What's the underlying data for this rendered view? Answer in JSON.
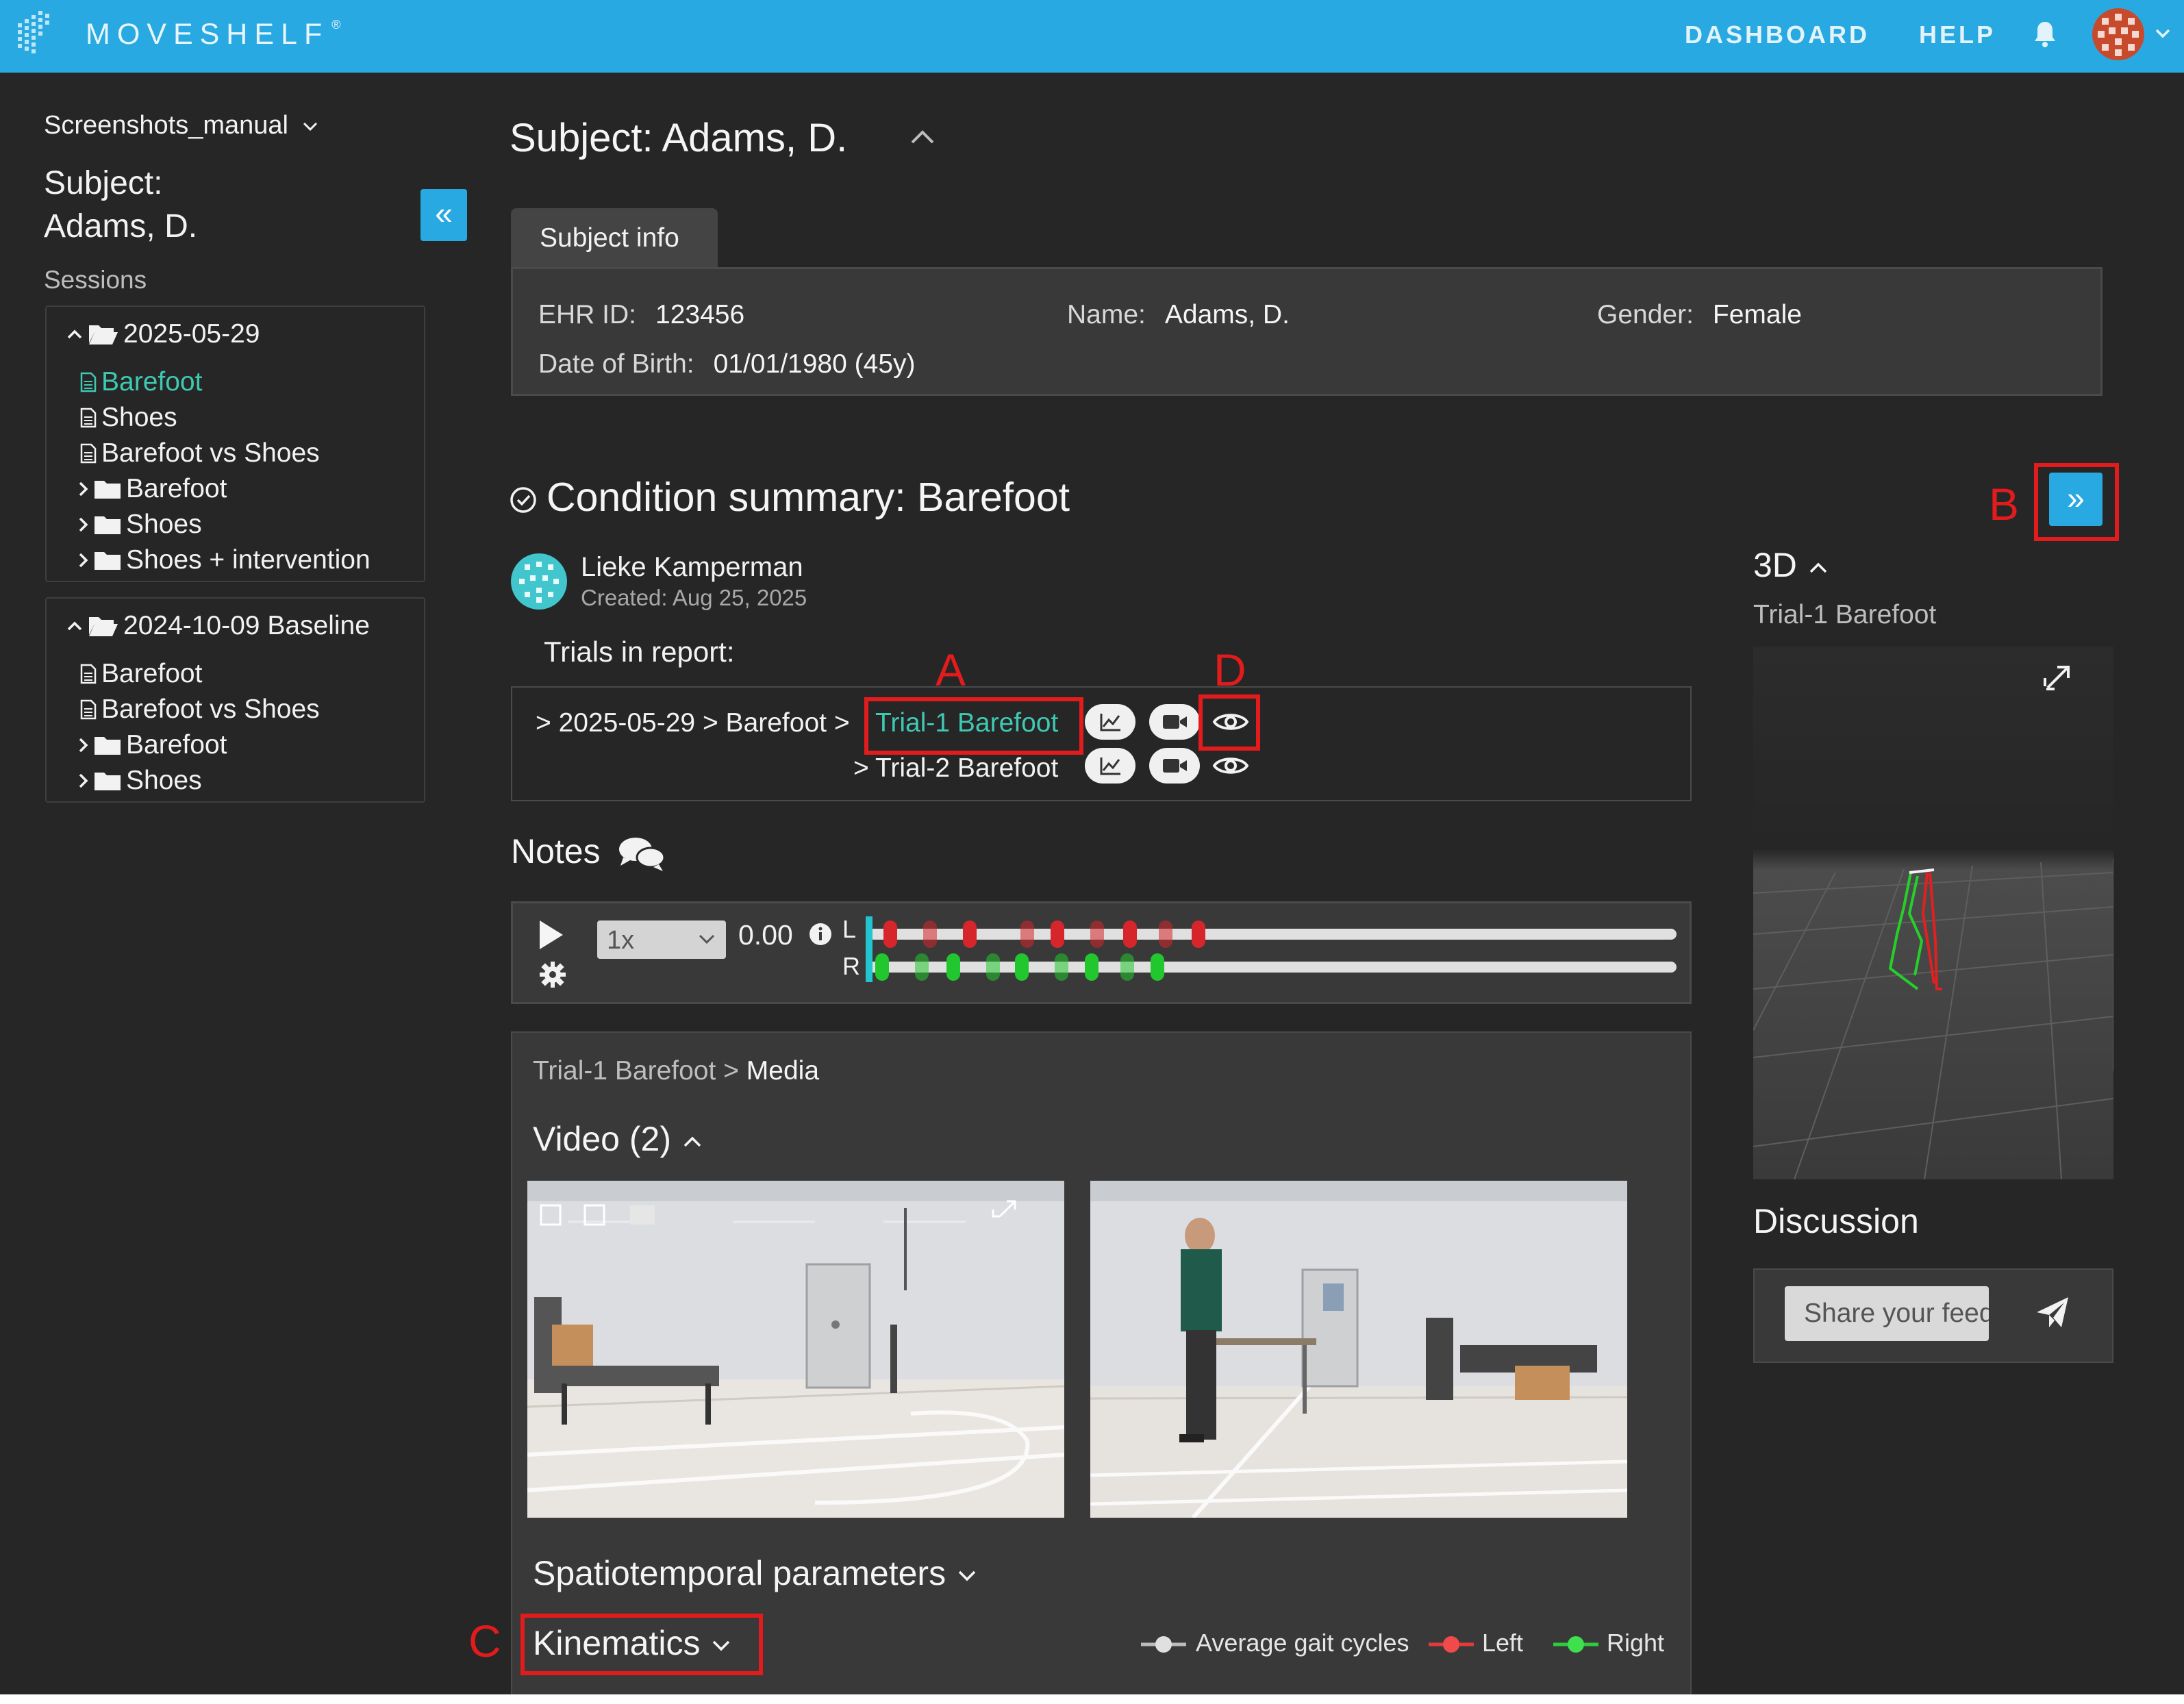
{
  "topbar": {
    "logo": "MOVESHELF",
    "logo_mark": "®",
    "nav": {
      "dashboard": "DASHBOARD",
      "help": "HELP"
    },
    "icons": [
      "logo-icon",
      "bell-icon",
      "user-avatar",
      "chevron-down-icon"
    ]
  },
  "sidebar": {
    "project": "Screenshots_manual",
    "subject_line1": "Subject:",
    "subject_line2": "Adams, D.",
    "collapse_label": "«",
    "sessions_label": "Sessions",
    "sessions": [
      {
        "date": "2025-05-29",
        "items": [
          {
            "label": "Barefoot",
            "type": "report",
            "active": true
          },
          {
            "label": "Shoes",
            "type": "report"
          },
          {
            "label": "Barefoot vs Shoes",
            "type": "report"
          },
          {
            "label": "Barefoot",
            "type": "folder"
          },
          {
            "label": "Shoes",
            "type": "folder"
          },
          {
            "label": "Shoes + intervention",
            "type": "folder"
          }
        ]
      },
      {
        "date": "2024-10-09 Baseline",
        "items": [
          {
            "label": "Barefoot",
            "type": "report"
          },
          {
            "label": "Barefoot vs Shoes",
            "type": "report"
          },
          {
            "label": "Barefoot",
            "type": "folder"
          },
          {
            "label": "Shoes",
            "type": "folder"
          }
        ]
      }
    ]
  },
  "main": {
    "title": "Subject: Adams, D.",
    "tab": "Subject info",
    "info": {
      "ehr_label": "EHR ID:",
      "ehr_value": "123456",
      "name_label": "Name:",
      "name_value": "Adams, D.",
      "gender_label": "Gender:",
      "gender_value": "Female",
      "dob_label": "Date of Birth:",
      "dob_value": "01/01/1980 (45y)"
    },
    "condition_title": "Condition summary: Barefoot",
    "author": {
      "name": "Lieke Kamperman",
      "created": "Created: Aug 25, 2025"
    },
    "trials_label": "Trials in report:",
    "trials": [
      {
        "prefix": "> 2025-05-29 > Barefoot >",
        "name": "Trial-1 Barefoot"
      },
      {
        "prefix": ">",
        "name": "Trial-2 Barefoot"
      }
    ],
    "notes_label": "Notes",
    "player": {
      "speed": "1x",
      "time": "0.00",
      "left": "L",
      "right": "R",
      "progress": 0
    },
    "media": {
      "crumb_trial": "Trial-1 Barefoot",
      "crumb_sep": ">",
      "crumb_current": "Media",
      "video_title": "Video (2)",
      "spatiotemporal": "Spatiotemporal parameters",
      "kinematics": "Kinematics",
      "legend": {
        "average": "Average gait cycles",
        "left": "Left",
        "right": "Right"
      }
    }
  },
  "right_panel": {
    "title_3d": "3D",
    "trial_3d": "Trial-1 Barefoot",
    "discussion": "Discussion",
    "feedback_placeholder": "Share your feedback"
  },
  "annotations": {
    "A": "A",
    "B": "B",
    "C": "C",
    "D": "D"
  },
  "colors": {
    "accent": "#29a9e1",
    "teal": "#3ec9b3",
    "left": "#d6262c",
    "right": "#22c62e",
    "annotation": "#e21c1c",
    "background": "#262626"
  }
}
